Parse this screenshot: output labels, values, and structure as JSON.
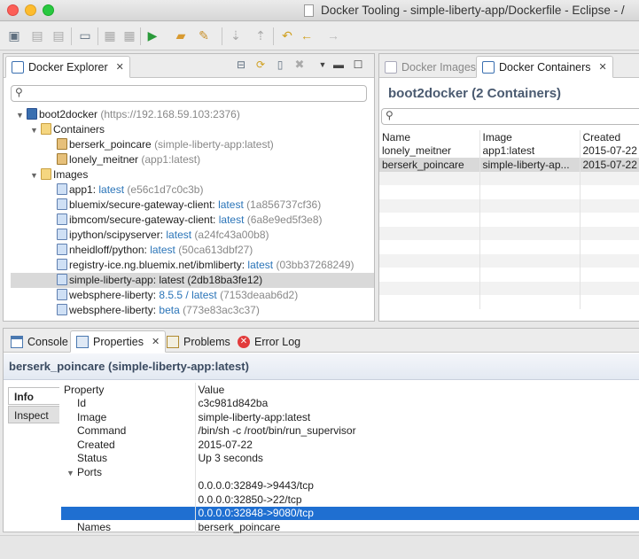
{
  "window": {
    "title": "Docker Tooling - simple-liberty-app/Dockerfile - Eclipse - /"
  },
  "explorer": {
    "tab_label": "Docker Explorer",
    "connection": {
      "name": "boot2docker",
      "url": "(https://192.168.59.103:2376)"
    },
    "containers_label": "Containers",
    "containers": [
      {
        "name": "berserk_poincare",
        "image": "(simple-liberty-app:latest)"
      },
      {
        "name": "lonely_meitner",
        "image": "(app1:latest)"
      }
    ],
    "images_label": "Images",
    "images": [
      {
        "name": "app1:",
        "tag": "latest",
        "id": "(e56c1d7c0c3b)"
      },
      {
        "name": "bluemix/secure-gateway-client:",
        "tag": "latest",
        "id": "(1a856737cf36)"
      },
      {
        "name": "ibmcom/secure-gateway-client:",
        "tag": "latest",
        "id": "(6a8e9ed5f3e8)"
      },
      {
        "name": "ipython/scipyserver:",
        "tag": "latest",
        "id": "(a24fc43a00b8)"
      },
      {
        "name": "nheidloff/python:",
        "tag": "latest",
        "id": "(50ca613dbf27)"
      },
      {
        "name": "registry-ice.ng.bluemix.net/ibmliberty:",
        "tag": "latest",
        "id": "(03bb37268249)"
      },
      {
        "name": "simple-liberty-app:",
        "tag": "latest",
        "id": "(2db18ba3fe12)"
      },
      {
        "name": "websphere-liberty:",
        "tag": "8.5.5 / latest",
        "id": "(7153deaab6d2)"
      },
      {
        "name": "websphere-liberty:",
        "tag": "beta",
        "id": "(773e83ac3c37)"
      }
    ]
  },
  "containers_view": {
    "tab_images": "Docker Images",
    "tab_containers": "Docker Containers",
    "heading": "boot2docker (2 Containers)",
    "columns": [
      "Name",
      "Image",
      "Created"
    ],
    "rows": [
      [
        "lonely_meitner",
        "app1:latest",
        "2015-07-22"
      ],
      [
        "berserk_poincare",
        "simple-liberty-ap...",
        "2015-07-22"
      ]
    ]
  },
  "bottom_tabs": {
    "console": "Console",
    "properties": "Properties",
    "problems": "Problems",
    "error_log": "Error Log"
  },
  "properties": {
    "heading": "berserk_poincare (simple-liberty-app:latest)",
    "side_tabs": [
      "Info",
      "Inspect"
    ],
    "col_property": "Property",
    "col_value": "Value",
    "rows": [
      [
        "Id",
        "c3c981d842ba"
      ],
      [
        "Image",
        "simple-liberty-app:latest"
      ],
      [
        "Command",
        "/bin/sh -c /root/bin/run_supervisor"
      ],
      [
        "Created",
        "2015-07-22"
      ],
      [
        "Status",
        "Up 3 seconds"
      ]
    ],
    "ports_label": "Ports",
    "ports": [
      "0.0.0.0:32849->9443/tcp",
      "0.0.0.0:32850->22/tcp",
      "0.0.0.0:32848->9080/tcp"
    ],
    "names_label": "Names",
    "names_value": "berserk_poincare"
  }
}
